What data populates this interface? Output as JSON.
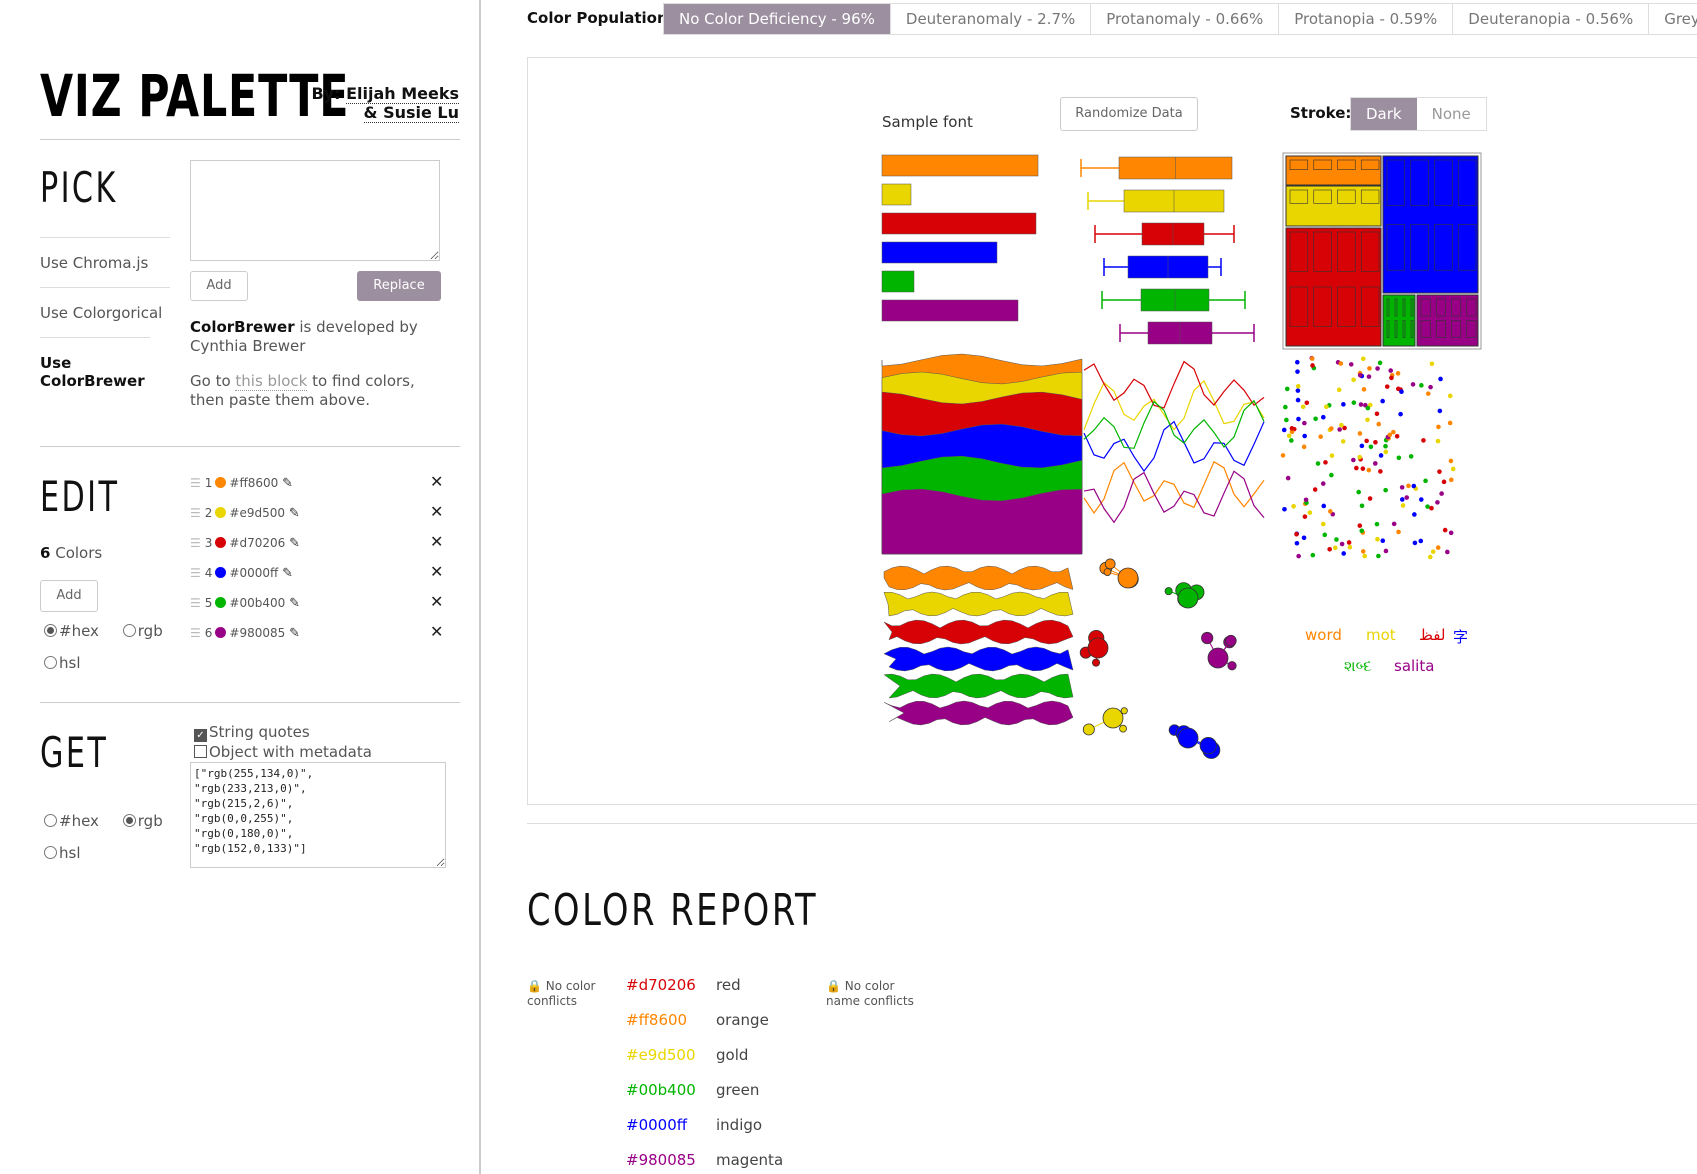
{
  "app": {
    "title": "VIZ PALETTE",
    "by_label": "By:",
    "author1": "Elijah Meeks",
    "author2": "& Susie Lu"
  },
  "pick": {
    "title": "PICK",
    "nav": [
      "Use Chroma.js",
      "Use Colorgorical",
      "Use ColorBrewer"
    ],
    "add_label": "Add",
    "replace_label": "Replace",
    "credit_name": "ColorBrewer",
    "credit_rest": "is developed by Cynthia Brewer",
    "go_pre": "Go to",
    "go_link": "this block",
    "go_post": "to find colors, then paste them above."
  },
  "edit": {
    "title": "EDIT",
    "count": "6",
    "count_label": "Colors",
    "add_label": "Add",
    "colors": [
      {
        "num": "1",
        "hex": "#ff8600"
      },
      {
        "num": "2",
        "hex": "#e9d500"
      },
      {
        "num": "3",
        "hex": "#d70206"
      },
      {
        "num": "4",
        "hex": "#0000ff"
      },
      {
        "num": "5",
        "hex": "#00b400"
      },
      {
        "num": "6",
        "hex": "#980085"
      }
    ],
    "formats": [
      "#hex",
      "rgb",
      "hsl"
    ]
  },
  "get": {
    "title": "GET",
    "string_quotes": "String quotes",
    "object_meta": "Object with metadata",
    "output": "[\"rgb(255,134,0)\",\n\"rgb(233,213,0)\",\n\"rgb(215,2,6)\",\n\"rgb(0,0,255)\",\n\"rgb(0,180,0)\",\n\"rgb(152,0,133)\"]",
    "formats": [
      "#hex",
      "rgb",
      "hsl"
    ]
  },
  "population": {
    "label": "Color Population:",
    "tabs": [
      "No Color Deficiency - 96%",
      "Deuteranomaly - 2.7%",
      "Protanomaly - 0.66%",
      "Protanopia - 0.59%",
      "Deuteranopia - 0.56%",
      "Greyscale"
    ]
  },
  "preview": {
    "sample_font": "Sample font",
    "randomize": "Randomize Data",
    "stroke_label": "Stroke:",
    "stroke_dark": "Dark",
    "stroke_none": "None",
    "words": [
      "word",
      "mot",
      "لفظ",
      "字",
      "શબ્દ",
      "salita"
    ]
  },
  "report": {
    "title": "COLOR REPORT",
    "conflicts": "No color conflicts",
    "name_conflicts": "No color name conflicts",
    "rows": [
      {
        "hex": "#d70206",
        "name": "red"
      },
      {
        "hex": "#ff8600",
        "name": "orange"
      },
      {
        "hex": "#e9d500",
        "name": "gold"
      },
      {
        "hex": "#00b400",
        "name": "green"
      },
      {
        "hex": "#0000ff",
        "name": "indigo"
      },
      {
        "hex": "#980085",
        "name": "magenta"
      }
    ]
  }
}
